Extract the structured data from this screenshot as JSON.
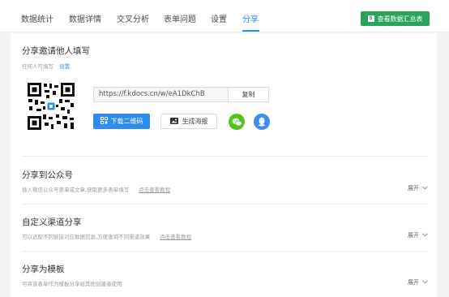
{
  "nav": {
    "tabs": [
      {
        "label": "数据统计"
      },
      {
        "label": "数据详情"
      },
      {
        "label": "交叉分析"
      },
      {
        "label": "表单问题"
      },
      {
        "label": "设置"
      },
      {
        "label": "分享"
      }
    ],
    "active_tab": "分享",
    "summary_button": "查看数据汇总表"
  },
  "invite": {
    "title": "分享邀请他人填写",
    "permission_text": "任何人可填写",
    "settings_link": "设置",
    "url": "https://f.kdocs.cn/w/eA1DkChB",
    "copy_label": "复制",
    "download_qr_label": "下载二维码",
    "poster_label": "生成海报",
    "share_icons": [
      "wechat-icon",
      "qq-icon"
    ]
  },
  "sections": [
    {
      "title": "分享到公众号",
      "description": "插入微信公众号菜单或文章,获取更多表单填写",
      "tutorial_link": "点击查看教程",
      "expand_label": "展开"
    },
    {
      "title": "自定义渠道分享",
      "description": "可以适配不同链接对应数据信息,方便查询不同渠道效果",
      "tutorial_link": "点击查看教程",
      "expand_label": "展开"
    },
    {
      "title": "分享为模板",
      "description": "可将该表单作为模板分享给其他创建者使用",
      "tutorial_link": "",
      "expand_label": "展开"
    }
  ],
  "colors": {
    "accent": "#2d8cf0",
    "summary_green": "#2aa35c",
    "wechat_green": "#52c41a",
    "qq_blue": "#3f8cf7"
  }
}
